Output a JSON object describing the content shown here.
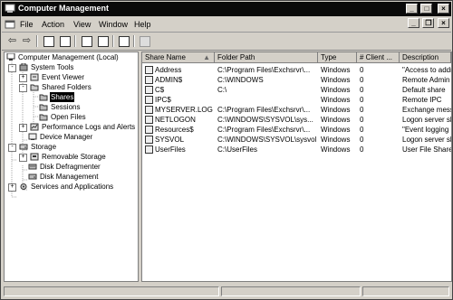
{
  "window": {
    "title": "Computer Management"
  },
  "menu": {
    "items": [
      "File",
      "Action",
      "View",
      "Window",
      "Help"
    ]
  },
  "tree": {
    "nodes": [
      {
        "label": "Computer Management (Local)",
        "expander": ""
      },
      {
        "label": "System Tools",
        "expander": "-"
      },
      {
        "label": "Event Viewer",
        "expander": "+"
      },
      {
        "label": "Shared Folders",
        "expander": "-"
      },
      {
        "label": "Shares",
        "expander": ""
      },
      {
        "label": "Sessions",
        "expander": ""
      },
      {
        "label": "Open Files",
        "expander": ""
      },
      {
        "label": "Performance Logs and Alerts",
        "expander": "+"
      },
      {
        "label": "Device Manager",
        "expander": ""
      },
      {
        "label": "Storage",
        "expander": "-"
      },
      {
        "label": "Removable Storage",
        "expander": "+"
      },
      {
        "label": "Disk Defragmenter",
        "expander": ""
      },
      {
        "label": "Disk Management",
        "expander": ""
      },
      {
        "label": "Services and Applications",
        "expander": "+"
      }
    ]
  },
  "list": {
    "headers": [
      "Share Name",
      "Folder Path",
      "Type",
      "# Client ...",
      "Description"
    ],
    "rows": [
      [
        "Address",
        "C:\\Program Files\\Exchsrvr\\...",
        "Windows",
        "0",
        "\"Access to addr"
      ],
      [
        "ADMIN$",
        "C:\\WINDOWS",
        "Windows",
        "0",
        "Remote Admin"
      ],
      [
        "C$",
        "C:\\",
        "Windows",
        "0",
        "Default share"
      ],
      [
        "IPC$",
        "",
        "Windows",
        "0",
        "Remote IPC"
      ],
      [
        "MYSERVER.LOG",
        "C:\\Program Files\\Exchsrvr\\...",
        "Windows",
        "0",
        "Exchange mess"
      ],
      [
        "NETLOGON",
        "C:\\WINDOWS\\SYSVOL\\sys...",
        "Windows",
        "0",
        "Logon server sh"
      ],
      [
        "Resources$",
        "C:\\Program Files\\Exchsrvr\\...",
        "Windows",
        "0",
        "\"Event logging i"
      ],
      [
        "SYSVOL",
        "C:\\WINDOWS\\SYSVOL\\sysvol",
        "Windows",
        "0",
        "Logon server sh"
      ],
      [
        "UserFiles",
        "C:\\UserFiles",
        "Windows",
        "0",
        "User File Share"
      ]
    ]
  }
}
